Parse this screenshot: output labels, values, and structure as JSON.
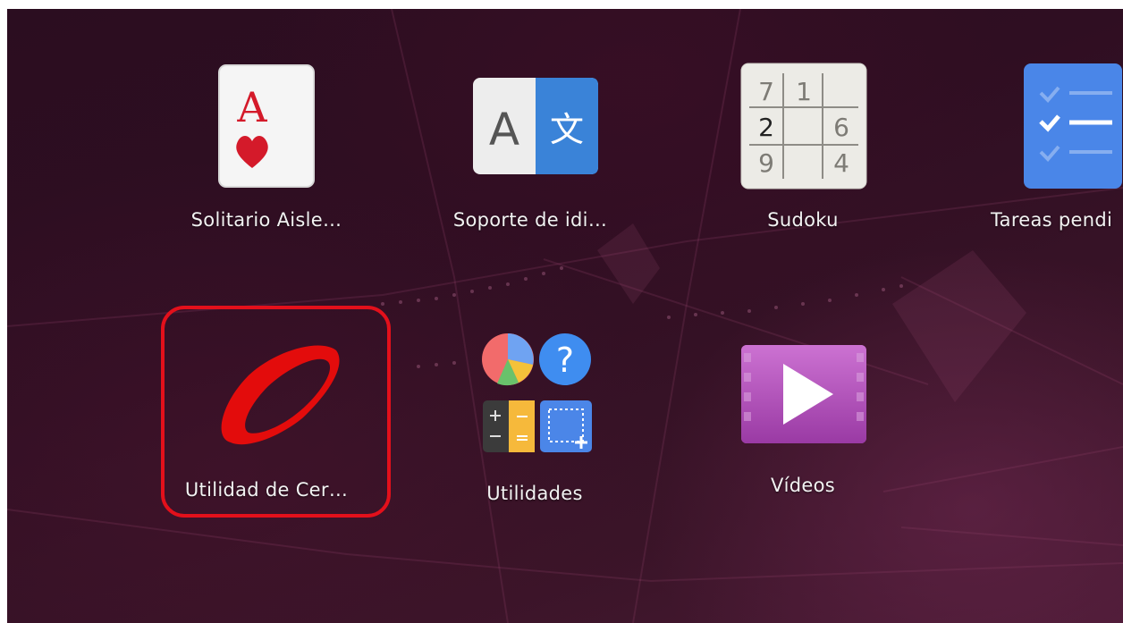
{
  "apps": [
    {
      "id": "solitaire",
      "label": "Solitario Aisle…",
      "icon": "solitaire-card-icon",
      "card_rank": "A"
    },
    {
      "id": "language",
      "label": "Soporte de idi…",
      "icon": "language-support-icon",
      "glyph_left": "A",
      "glyph_right": "文"
    },
    {
      "id": "sudoku",
      "label": "Sudoku",
      "icon": "sudoku-icon",
      "grid": [
        "7",
        "1",
        "",
        "2",
        "",
        "6",
        "9",
        "",
        "4"
      ]
    },
    {
      "id": "tasks",
      "label": "Tareas pendi",
      "icon": "todo-checklist-icon"
    },
    {
      "id": "cert",
      "label": "Utilidad de Cer…",
      "icon": "certificate-utility-icon",
      "highlighted": true
    },
    {
      "id": "utilities",
      "label": "Utilidades",
      "icon": "utilities-folder-icon",
      "help_glyph": "?"
    },
    {
      "id": "videos",
      "label": "Vídeos",
      "icon": "videos-play-icon"
    }
  ],
  "colors": {
    "highlight": "#e3101b",
    "background": "#2f0e22",
    "label_text": "#f2f2f2"
  }
}
